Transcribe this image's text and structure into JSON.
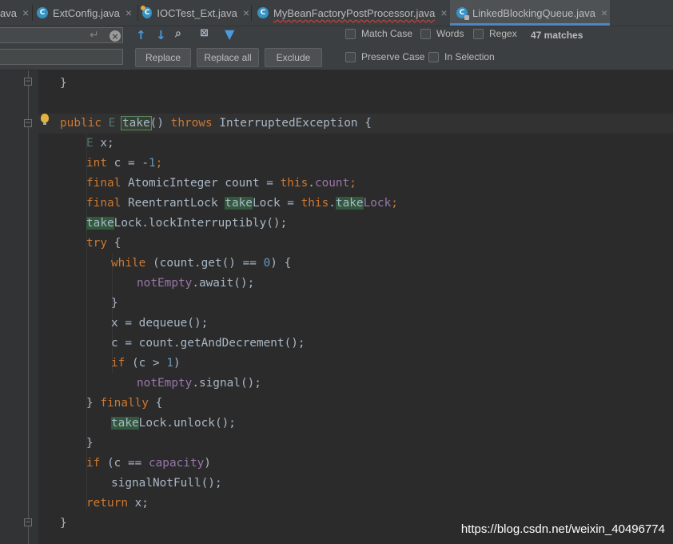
{
  "tabs": [
    {
      "label": "ava",
      "icon": "none",
      "active": false
    },
    {
      "label": "ExtConfig.java",
      "icon": "class-icon",
      "active": false
    },
    {
      "label": "IOCTest_Ext.java",
      "icon": "class-gear-icon",
      "active": false
    },
    {
      "label": "MyBeanFactoryPostProcessor.java",
      "icon": "class-icon",
      "active": false
    },
    {
      "label": "LinkedBlockingQueue.java",
      "icon": "class-locked-icon",
      "active": true
    }
  ],
  "tab_close": "×",
  "find": {
    "search_value": "",
    "replace_value": "",
    "match_case": "Match Case",
    "words": "Words",
    "regex": "Regex",
    "matches": "47 matches",
    "preserve_case": "Preserve Case",
    "in_selection": "In Selection",
    "replace": "Replace",
    "replace_all": "Replace all",
    "exclude": "Exclude"
  },
  "code": {
    "close_brace_1": "}",
    "sig_public": "public",
    "sig_type": "E",
    "sig_name": "take",
    "sig_paren": "()",
    "sig_throws": "throws",
    "sig_exc": "InterruptedException {",
    "decl_type": "E",
    "decl_var": " x;",
    "int_kw": "int",
    "int_rest_a": " c = -",
    "int_num": "1",
    "int_rest_b": ";",
    "final_kw": "final",
    "count_mid": " AtomicInteger count = ",
    "this_kw": "this",
    "dot": ".",
    "count_field": "count",
    "semi": ";",
    "lock_mid": " ReentrantLock ",
    "take": "take",
    "lock_suffix": "Lock",
    "lock_eq": " = ",
    "lock_field_suffix": "Lock",
    "lock_call": "Lock.lockInterruptibly();",
    "try_kw": "try",
    "open_brace": " {",
    "while_kw": "while",
    "while_cond_a": " (count.get() == ",
    "zero": "0",
    "while_cond_b": ") {",
    "notempty": "notEmpty",
    "await_call": ".await();",
    "close_brace": "}",
    "dequeue": "x = dequeue();",
    "decrement": "c = count.getAndDecrement();",
    "if_kw": "if",
    "if_cond_a": " (c > ",
    "one": "1",
    "if_cond_b": ")",
    "signal_call": ".signal();",
    "finally_open": "} ",
    "finally_kw": "finally",
    "unlock_call": "Lock.unlock();",
    "if2_cond_a": " (c == ",
    "capacity": "capacity",
    "if2_cond_b": ")",
    "signal_not_full": "signalNotFull();",
    "return_kw": "return",
    "return_rest": " x;",
    "close_brace_end": "}"
  },
  "watermark": "https://blog.csdn.net/weixin_40496774",
  "colors": {
    "keyword": "#cc7832",
    "number": "#6897bb",
    "field": "#9876aa",
    "type_param": "#507874",
    "text": "#a9b7c6",
    "highlight": "#32593d",
    "background": "#2b2b2b"
  }
}
